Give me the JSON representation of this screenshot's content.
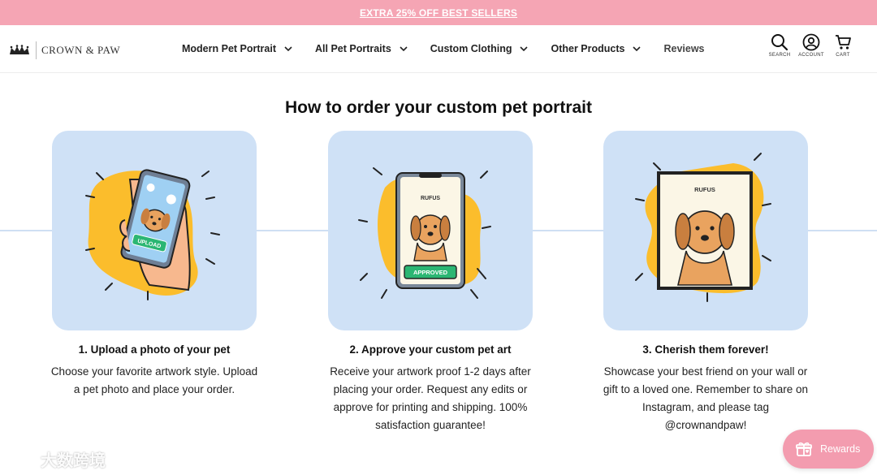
{
  "promo": {
    "text": "EXTRA 25% OFF BEST SELLERS"
  },
  "brand": {
    "name": "CROWN & PAW"
  },
  "nav": {
    "items": [
      {
        "label": "Modern Pet Portrait",
        "dropdown": true
      },
      {
        "label": "All Pet Portraits",
        "dropdown": true
      },
      {
        "label": "Custom Clothing",
        "dropdown": true
      },
      {
        "label": "Other Products",
        "dropdown": true
      },
      {
        "label": "Reviews",
        "dropdown": false
      }
    ]
  },
  "header_icons": {
    "search": "SEARCH",
    "account": "ACCOUNT",
    "cart": "CART"
  },
  "page": {
    "title": "How to order your custom pet portrait"
  },
  "steps": [
    {
      "title": "1. Upload a photo of your pet",
      "body": "Choose your favorite artwork style. Upload a pet photo and place your order.",
      "badge": "UPLOAD"
    },
    {
      "title": "2. Approve your custom pet art",
      "body": "Receive your artwork proof 1-2 days after placing your order. Request any edits or approve for printing and shipping. 100% satisfaction guarantee!",
      "name_tag": "RUFUS",
      "badge": "APPROVED"
    },
    {
      "title": "3. Cherish them forever!",
      "body": "Showcase your best friend on your wall or gift to a loved one. Remember to share on Instagram, and please tag @crownandpaw!",
      "name_tag": "RUFUS"
    }
  ],
  "rewards": {
    "label": "Rewards"
  },
  "watermark": {
    "text": "大数跨境"
  },
  "colors": {
    "promo_bg": "#f5a5b4",
    "card_bg": "#cfe1f6",
    "blob_yellow": "#fbbd2c",
    "badge_green": "#2bb673",
    "dog_orange": "#e9a35f",
    "rewards_bg": "#f39caf"
  }
}
